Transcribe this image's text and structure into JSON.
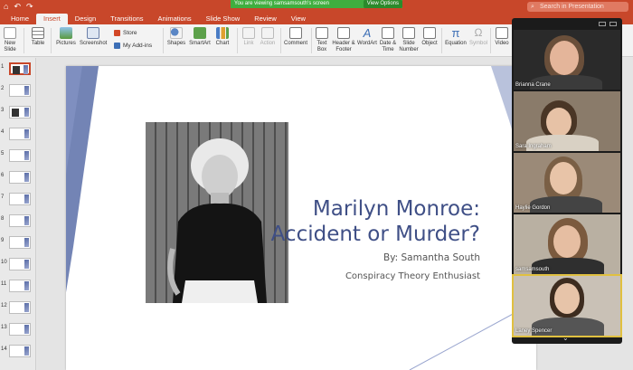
{
  "titlebar": {
    "quick_access": [
      "⌂",
      "↶",
      "↷"
    ],
    "search_placeholder": "Search in Presentation"
  },
  "share_banner": {
    "text": "You are viewing samsamsouth's screen",
    "button": "View Options"
  },
  "ribbon_tabs": [
    "Home",
    "Insert",
    "Design",
    "Transitions",
    "Animations",
    "Slide Show",
    "Review",
    "View"
  ],
  "active_tab": "Insert",
  "ribbon": {
    "new_slide": "New Slide",
    "table": "Table",
    "pictures": "Pictures",
    "screenshot": "Screenshot",
    "store": "Store",
    "my_addins": "My Add-ins",
    "shapes": "Shapes",
    "smartart": "SmartArt",
    "chart": "Chart",
    "link": "Link",
    "action": "Action",
    "comment": "Comment",
    "text_box": "Text Box",
    "header_footer": "Header & Footer",
    "wordart": "WordArt",
    "date_time": "Date & Time",
    "slide_number": "Slide Number",
    "object": "Object",
    "equation": "Equation",
    "symbol": "Symbol",
    "video": "Video"
  },
  "slide_numbers": [
    "1",
    "2",
    "3",
    "4",
    "5",
    "6",
    "7",
    "8",
    "9",
    "10",
    "11",
    "12",
    "13",
    "14"
  ],
  "slide": {
    "title_line1": "Marilyn Monroe:",
    "title_line2": "Accident or Murder?",
    "byline": "By: Samantha South",
    "subtitle": "Conspiracy Theory Enthusiast",
    "accent_color": "#5b6ea8",
    "title_color": "#3f4f86"
  },
  "participants": [
    {
      "name": "Brianna Crane"
    },
    {
      "name": "Sara Ingraham"
    },
    {
      "name": "Haylie Gordon"
    },
    {
      "name": "samsamsouth"
    },
    {
      "name": "Laney Spencer"
    }
  ],
  "icons": {
    "search": "search-icon",
    "chevron": "chevron-down-icon"
  }
}
